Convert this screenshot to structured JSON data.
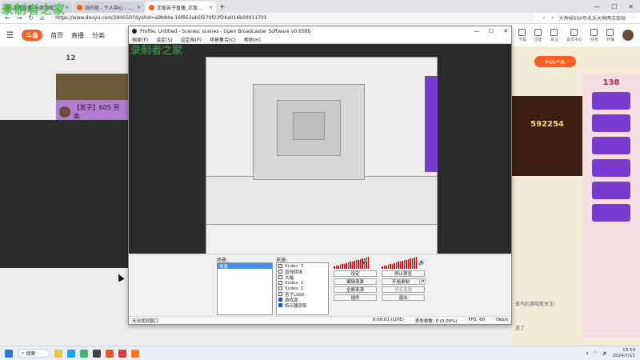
{
  "browser": {
    "tabs": [
      {
        "label": "游戏直播_全部游戏直播_斗鱼直播",
        "active": false
      },
      {
        "label": "站内信 - 个人中心 - 斗鱼",
        "active": false
      },
      {
        "label": "正版苦子直播_正版苦子直播_正...",
        "active": true
      }
    ],
    "new_tab": "+",
    "window_controls": {
      "min": "—",
      "max": "☐",
      "close": "✕"
    },
    "url": "https://www.douyu.com/2845507dyshid=a9b84a-16f653ab5f270f23f24a016b00011701",
    "right_text": "大神帧600年永乐大神两次现呦"
  },
  "douyu": {
    "logo": "斗鱼",
    "nav": [
      "首页",
      "直播",
      "分类"
    ],
    "level": "12",
    "right_icons": [
      "消息",
      "下载",
      "历史",
      "关注",
      "会员中心",
      "任务",
      "开播"
    ],
    "po_button": "POB产品",
    "card_title": "【苦子】60S 另类",
    "right_number": "138",
    "right_number2": "592254",
    "chat_lines": [
      "丢鸟的游戏就关注!",
      "送了"
    ]
  },
  "obs": {
    "title": "Profile: Untitled - Scenes: scenes - Open Broadcaster Software v0.658b",
    "menu": [
      "档案(F)",
      "设定(S)",
      "设定档(P)",
      "场景集合(C)",
      "帮助(H)"
    ],
    "scenes_label": "场景:",
    "scenes": [
      {
        "name": "场景",
        "selected": true
      }
    ],
    "sources_label": "来源:",
    "sources": [
      {
        "name": "Video 3",
        "checked": false
      },
      {
        "name": "直线转场",
        "checked": false
      },
      {
        "name": "大幅",
        "checked": false
      },
      {
        "name": "Video 2",
        "checked": false
      },
      {
        "name": "Video 1",
        "checked": false
      },
      {
        "name": "苦子LOGO",
        "checked": false
      },
      {
        "name": "游戏源",
        "checked": true
      },
      {
        "name": "特示器获取",
        "checked": true
      }
    ],
    "buttons": {
      "settings": "设定",
      "stop_preview": "停止预览",
      "edit_scene": "编辑场景",
      "start_recording": "开始录制",
      "fullscreen": "全屏来源",
      "preview_stream": "预览直播",
      "plugins": "插件",
      "exit": "退出"
    },
    "status": {
      "left": "无法找到窗口",
      "time": "0:00:01 (LIVE)",
      "dropped": "丢失帧数: 0 (0.00%)",
      "fps": "FPS: 60",
      "bitrate": "0kb/s"
    }
  },
  "taskbar": {
    "search": "搜索",
    "time": "19:53",
    "date": "2024/7/11"
  },
  "watermark": "录制者之家",
  "watermark2": "录制者之家"
}
